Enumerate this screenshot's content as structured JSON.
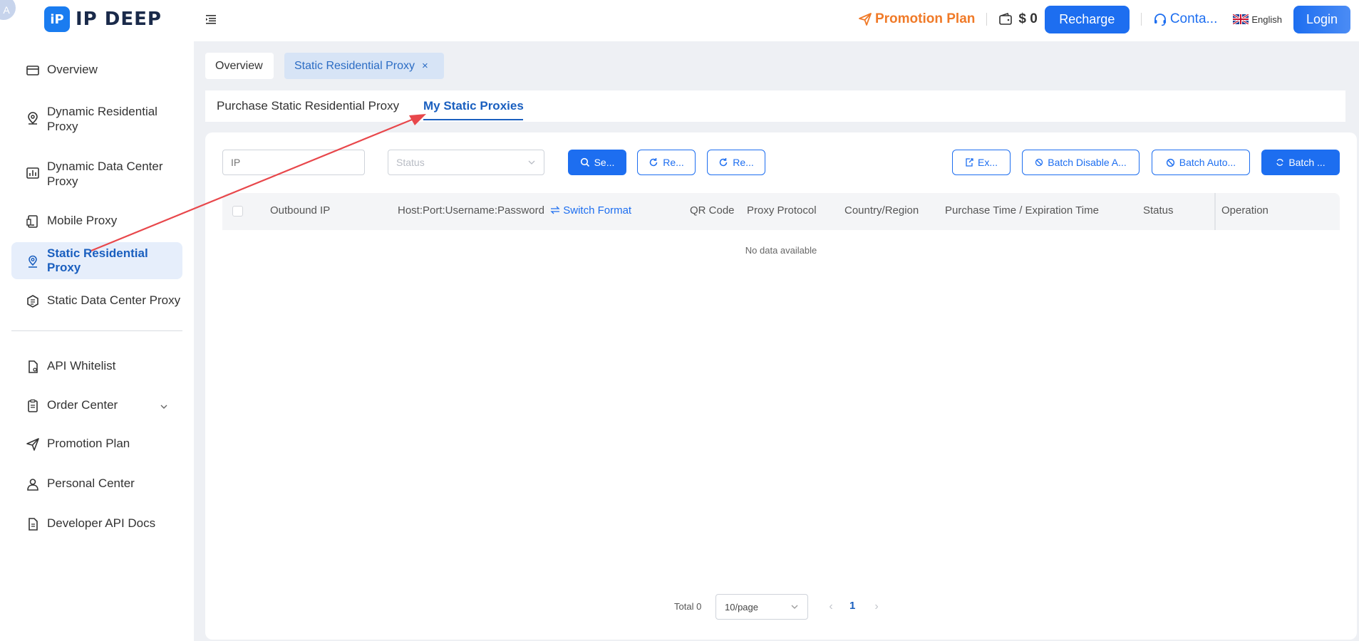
{
  "header": {
    "avatar_letter": "A",
    "logo_mark": "iP",
    "logo_text": "IP DEEP",
    "promotion": "Promotion Plan",
    "balance": "$ 0",
    "recharge": "Recharge",
    "contact": "Conta...",
    "language": "English",
    "login": "Login",
    "accent_color": "#1d6ef0",
    "promo_color": "#f07a28"
  },
  "sidebar": {
    "items": [
      {
        "label": "Overview",
        "icon": "card-icon"
      },
      {
        "label": "Dynamic Residential Proxy",
        "icon": "location-pin-icon"
      },
      {
        "label": "Dynamic Data Center Proxy",
        "icon": "bar-chart-icon"
      },
      {
        "label": "Mobile Proxy",
        "icon": "mobile-icon"
      },
      {
        "label": "Static Residential Proxy",
        "icon": "location-icon",
        "active": true
      },
      {
        "label": "Static Data Center Proxy",
        "icon": "cube-icon"
      },
      {
        "label": "API Whitelist",
        "icon": "document-icon"
      },
      {
        "label": "Order Center",
        "icon": "clipboard-icon"
      },
      {
        "label": "Promotion Plan",
        "icon": "send-icon"
      },
      {
        "label": "Personal Center",
        "icon": "user-icon"
      },
      {
        "label": "Developer API Docs",
        "icon": "doc-icon"
      }
    ]
  },
  "tabs": {
    "overview": "Overview",
    "static": "Static Residential Proxy",
    "close": "×"
  },
  "subtabs": {
    "purchase": "Purchase Static Residential Proxy",
    "my": "My Static Proxies"
  },
  "filters": {
    "ip_placeholder": "IP",
    "status_placeholder": "Status"
  },
  "toolbar": {
    "search": "Se...",
    "reset": "Re...",
    "refresh": "Re...",
    "export": "Ex...",
    "batch_disable": "Batch Disable A...",
    "batch_auto": "Batch Auto...",
    "batch": "Batch ..."
  },
  "table": {
    "columns": {
      "outbound_ip": "Outbound IP",
      "host": "Host:Port:Username:Password",
      "switch_format": "Switch Format",
      "qr": "QR Code",
      "protocol": "Proxy Protocol",
      "country": "Country/Region",
      "time": "Purchase Time / Expiration Time",
      "status": "Status",
      "operation": "Operation"
    },
    "empty": "No data available"
  },
  "pager": {
    "total": "Total 0",
    "page_size": "10/page",
    "prev": "‹",
    "next": "›",
    "current": "1"
  }
}
